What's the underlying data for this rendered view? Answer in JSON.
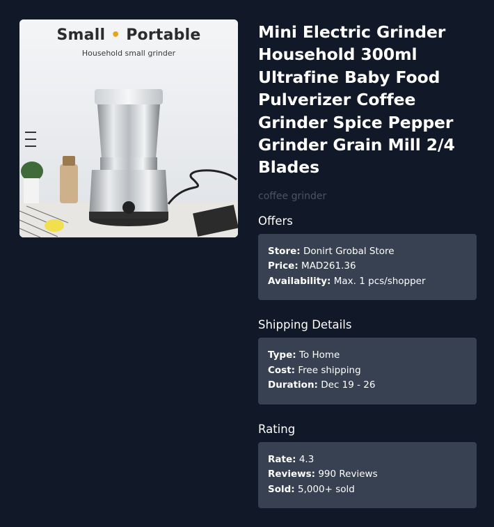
{
  "image": {
    "headline_part1": "Small",
    "headline_dot": "•",
    "headline_part2": "Portable",
    "subheadline": "Household small grinder"
  },
  "product": {
    "title": "Mini Electric Grinder Household 300ml Ultrafine Baby Food Pulverizer Coffee Grinder Spice Pepper Grinder Grain Mill 2/4 Blades",
    "category": "coffee grinder"
  },
  "offers": {
    "heading": "Offers",
    "store_label": "Store:",
    "store_value": "Donirt Grobal Store",
    "price_label": "Price:",
    "price_value": "MAD261.36",
    "availability_label": "Availability:",
    "availability_value": "Max. 1 pcs/shopper"
  },
  "shipping": {
    "heading": "Shipping Details",
    "type_label": "Type:",
    "type_value": "To Home",
    "cost_label": "Cost:",
    "cost_value": "Free shipping",
    "duration_label": "Duration:",
    "duration_value": "Dec 19 - 26"
  },
  "rating": {
    "heading": "Rating",
    "rate_label": "Rate:",
    "rate_value": "4.3",
    "reviews_label": "Reviews:",
    "reviews_value": "990 Reviews",
    "sold_label": "Sold:",
    "sold_value": "5,000+ sold"
  },
  "colors": {
    "background": "#111827",
    "card": "#374151",
    "muted_text": "#4b5563",
    "image_accent": "#e9a21c"
  }
}
